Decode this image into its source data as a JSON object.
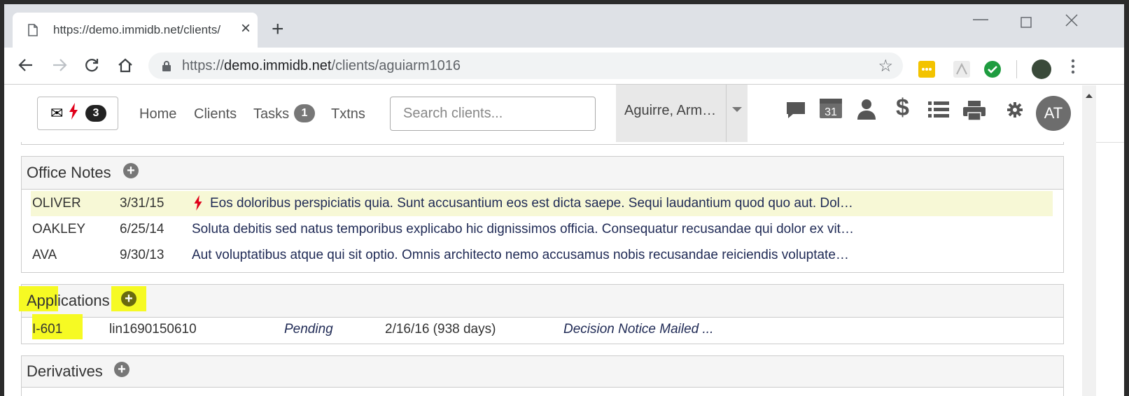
{
  "browser": {
    "tab_title": "https://demo.immidb.net/clients/",
    "new_tab": "+",
    "url_domain_prefix": "https://",
    "url_domain": "demo.immidb.net",
    "url_path": "/clients/aguiarm1016"
  },
  "nav": {
    "inbox_count": "3",
    "home": "Home",
    "clients": "Clients",
    "tasks": "Tasks",
    "tasks_count": "1",
    "txtns": "Txtns",
    "search_placeholder": "Search clients...",
    "client_name": "Aguirre, Arm…",
    "calendar_day": "31",
    "avatar": "AT"
  },
  "office_notes": {
    "title": "Office Notes",
    "rows": [
      {
        "author": "OLIVER",
        "date": "3/31/15",
        "text": "Eos doloribus perspiciatis quia. Sunt accusantium eos est dicta saepe. Sequi laudantium quod quo aut. Dol…",
        "urgent": true
      },
      {
        "author": "OAKLEY",
        "date": "6/25/14",
        "text": "Soluta debitis sed natus temporibus explicabo hic dignissimos officia. Consequatur recusandae qui dolor ex vit…",
        "urgent": false
      },
      {
        "author": "AVA",
        "date": "9/30/13",
        "text": "Aut voluptatibus atque qui sit optio. Omnis architecto nemo accusamus nobis recusandae reiciendis voluptate…",
        "urgent": false
      }
    ]
  },
  "applications": {
    "title": "Applications",
    "rows": [
      {
        "form": "I-601",
        "receipt": "lin1690150610",
        "status": "Pending",
        "date": "2/16/16 (938 days)",
        "last_action": "Decision Notice Mailed ..."
      }
    ]
  },
  "derivatives": {
    "title": "Derivatives"
  },
  "colors": {
    "highlight": "#f6fa23",
    "urgent_bolt": "#e0001a",
    "row_highlight": "#f7f8d6",
    "link_text": "#1f2a55"
  }
}
